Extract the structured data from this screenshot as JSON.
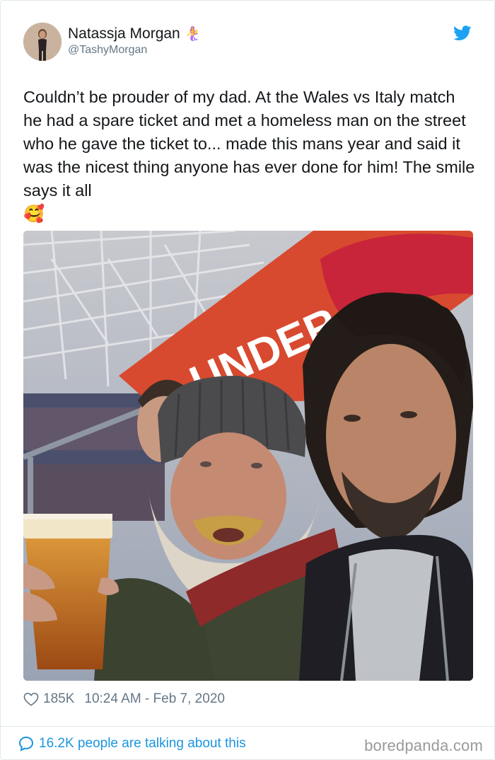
{
  "author": {
    "display_name": "Natassja Morgan",
    "name_emoji": "🧜‍♀️",
    "handle": "@TashyMorgan",
    "avatar_icon": "profile-photo",
    "platform_icon": "twitter-bird-icon"
  },
  "tweet": {
    "text": "Couldn’t be prouder of my dad. At the Wales vs Italy match he had a spare ticket and met a homeless man on the street who he gave the ticket to... made this mans year and said it was the nicest thing anyone has ever done for him! The smile says it all",
    "emoji": "🥰",
    "media_banner_text": "UNDER ARMOUR",
    "likes": "185K",
    "timestamp": "10:24 AM - Feb 7, 2020"
  },
  "footer": {
    "conversation_label": "16.2K people are talking about this",
    "watermark": "boredpanda.com"
  },
  "colors": {
    "link": "#1b95e0",
    "muted": "#657786",
    "text": "#14171a",
    "border": "#e1e8ed",
    "twitter_blue": "#1da1f2"
  }
}
